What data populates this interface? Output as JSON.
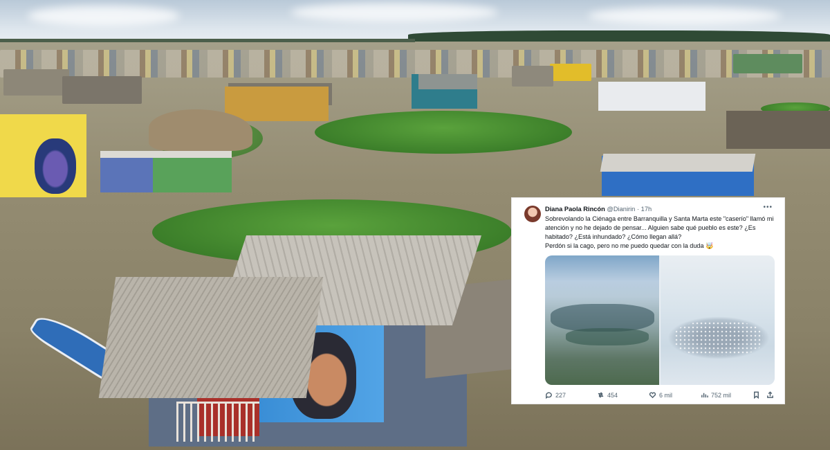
{
  "tweet": {
    "display_name": "Diana Paola Rincón",
    "handle": "@Dianirin",
    "separator": "·",
    "time": "17h",
    "more_icon": "more-dots-icon",
    "text_line1": "Sobrevolando la Ciénaga entre Barranquilla y Santa Marta este \"caserío\" llamó mi atención y no he dejado de pensar... Alguien sabe qué pueblo es este? ¿Es habitado? ¿Está inhundado? ¿Cómo llegan allá?",
    "text_line2": "Perdón si la cago, pero no me puedo quedar con la duda 🤯",
    "actions": {
      "replies": "227",
      "retweets": "454",
      "likes": "6 mil",
      "views": "752 mil"
    },
    "icons": {
      "reply": "reply-icon",
      "retweet": "retweet-icon",
      "like": "heart-icon",
      "views": "views-chart-icon",
      "bookmark": "bookmark-icon",
      "share": "share-icon"
    }
  }
}
